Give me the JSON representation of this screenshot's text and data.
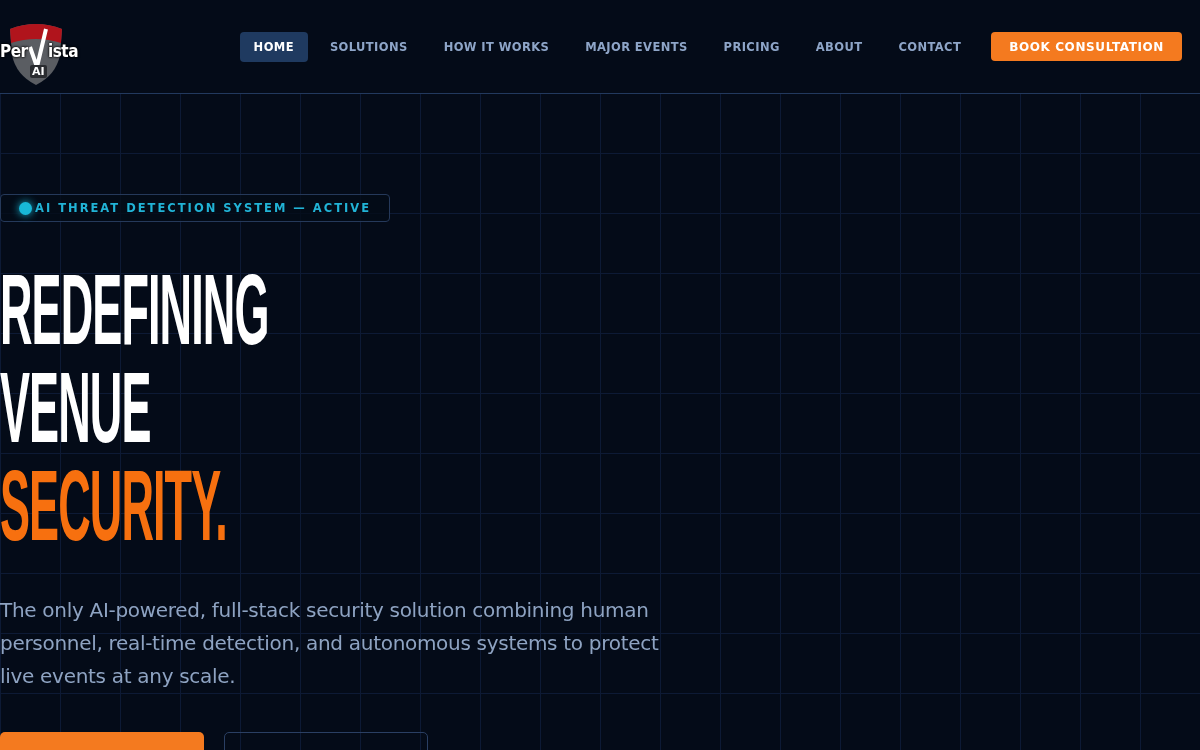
{
  "logo": {
    "left": "Per",
    "right": "ista",
    "badge": "AI"
  },
  "nav": [
    {
      "label": "HOME",
      "selected": true
    },
    {
      "label": "SOLUTIONS",
      "selected": false
    },
    {
      "label": "HOW IT WORKS",
      "selected": false
    },
    {
      "label": "MAJOR EVENTS",
      "selected": false
    },
    {
      "label": "PRICING",
      "selected": false
    },
    {
      "label": "ABOUT",
      "selected": false
    },
    {
      "label": "CONTACT",
      "selected": false
    }
  ],
  "cta": "BOOK CONSULTATION",
  "status_badge": {
    "label": "AI THREAT DETECTION SYSTEM — ACTIVE",
    "active": true
  },
  "headline": [
    {
      "text": "REDEFINING",
      "accent": false
    },
    {
      "text": "VENUE",
      "accent": false
    },
    {
      "text": "SECURITY.",
      "accent": true
    }
  ],
  "intro": "The only AI-powered, full-stack security solution combining human personnel, real-time detection, and autonomous systems to protect live events at any scale.",
  "buttons": [
    {
      "kind": "primary"
    },
    {
      "kind": "outline"
    }
  ]
}
